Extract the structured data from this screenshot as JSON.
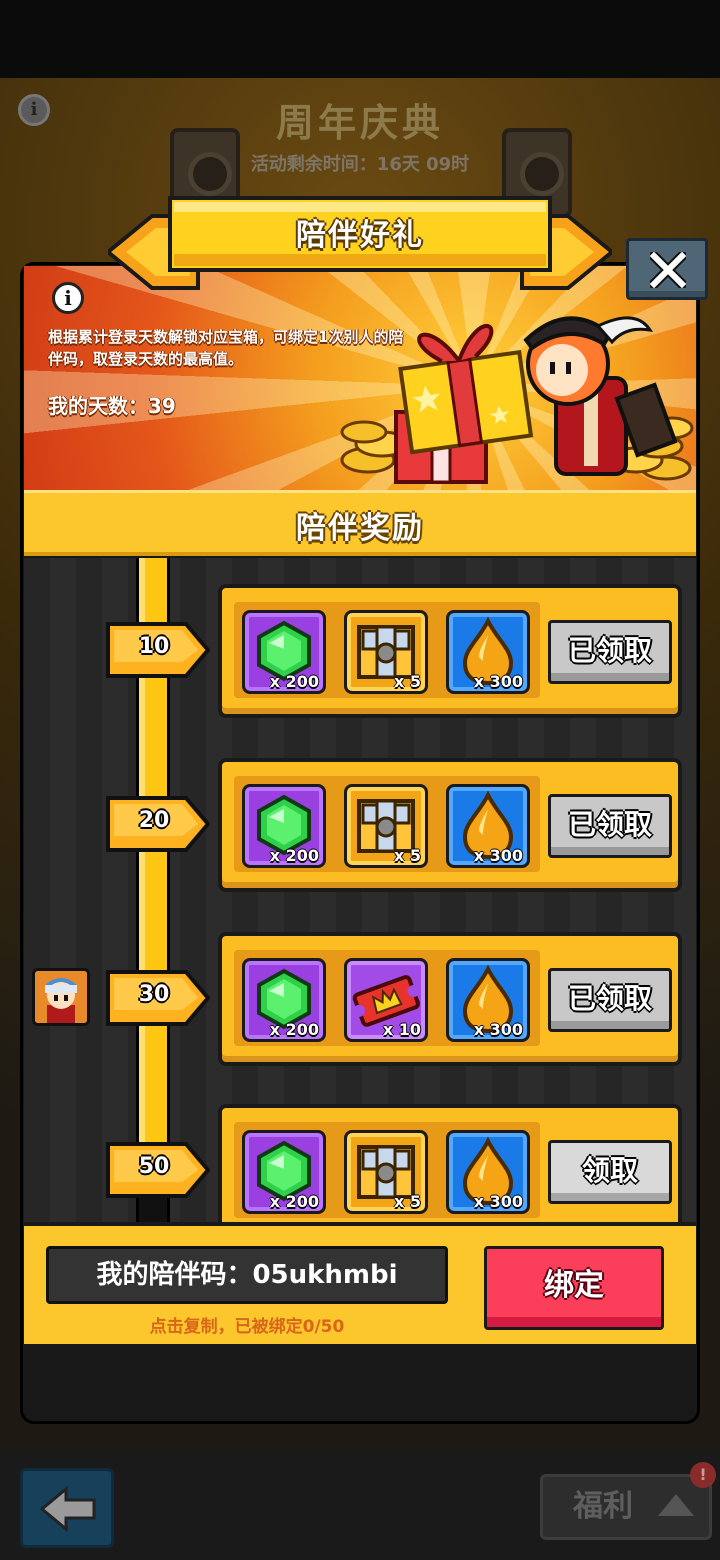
{
  "background": {
    "title": "周年庆典",
    "timer": "活动剩余时间：16天 09时",
    "welfare_button": "福利",
    "welfare_badge": "!"
  },
  "modal": {
    "title": "陪伴好礼",
    "info_icon": "i",
    "description": "根据累计登录天数解锁对应宝箱，可绑定1次别人的陪伴码，取登录天数的最高值。",
    "my_days_label": "我的天数：39",
    "section_title": "陪伴奖励",
    "progress_fraction": 0.86
  },
  "rewards": [
    {
      "day": "10",
      "items": [
        {
          "icon": "emerald-gem-icon",
          "qty": "x 200",
          "bg": "purple"
        },
        {
          "icon": "treasure-chest-icon",
          "qty": "x 5",
          "bg": "gold"
        },
        {
          "icon": "oil-drop-icon",
          "qty": "x 300",
          "bg": "blue"
        }
      ],
      "button": "已领取",
      "status": "claimed"
    },
    {
      "day": "20",
      "items": [
        {
          "icon": "emerald-gem-icon",
          "qty": "x 200",
          "bg": "purple"
        },
        {
          "icon": "treasure-chest-icon",
          "qty": "x 5",
          "bg": "gold"
        },
        {
          "icon": "oil-drop-icon",
          "qty": "x 300",
          "bg": "blue"
        }
      ],
      "button": "已领取",
      "status": "claimed"
    },
    {
      "day": "30",
      "items": [
        {
          "icon": "emerald-gem-icon",
          "qty": "x 200",
          "bg": "purple"
        },
        {
          "icon": "crown-ticket-icon",
          "qty": "x 10",
          "bg": "purple"
        },
        {
          "icon": "oil-drop-icon",
          "qty": "x 300",
          "bg": "blue"
        }
      ],
      "button": "已领取",
      "status": "claimed"
    },
    {
      "day": "50",
      "items": [
        {
          "icon": "emerald-gem-icon",
          "qty": "x 200",
          "bg": "purple"
        },
        {
          "icon": "treasure-chest-icon",
          "qty": "x 5",
          "bg": "gold"
        },
        {
          "icon": "oil-drop-icon",
          "qty": "x 300",
          "bg": "blue"
        }
      ],
      "button": "领取",
      "status": "claimable"
    }
  ],
  "footer": {
    "code_label": "我的陪伴码：05ukhmbi",
    "hint": "点击复制，已被绑定0/50",
    "bind_button": "绑定"
  },
  "colors": {
    "accent_yellow": "#fbc72c",
    "bind_red": "#fb3e5a",
    "hint_orange": "#d9661a",
    "claimed_gray": "#c8c8c8"
  }
}
